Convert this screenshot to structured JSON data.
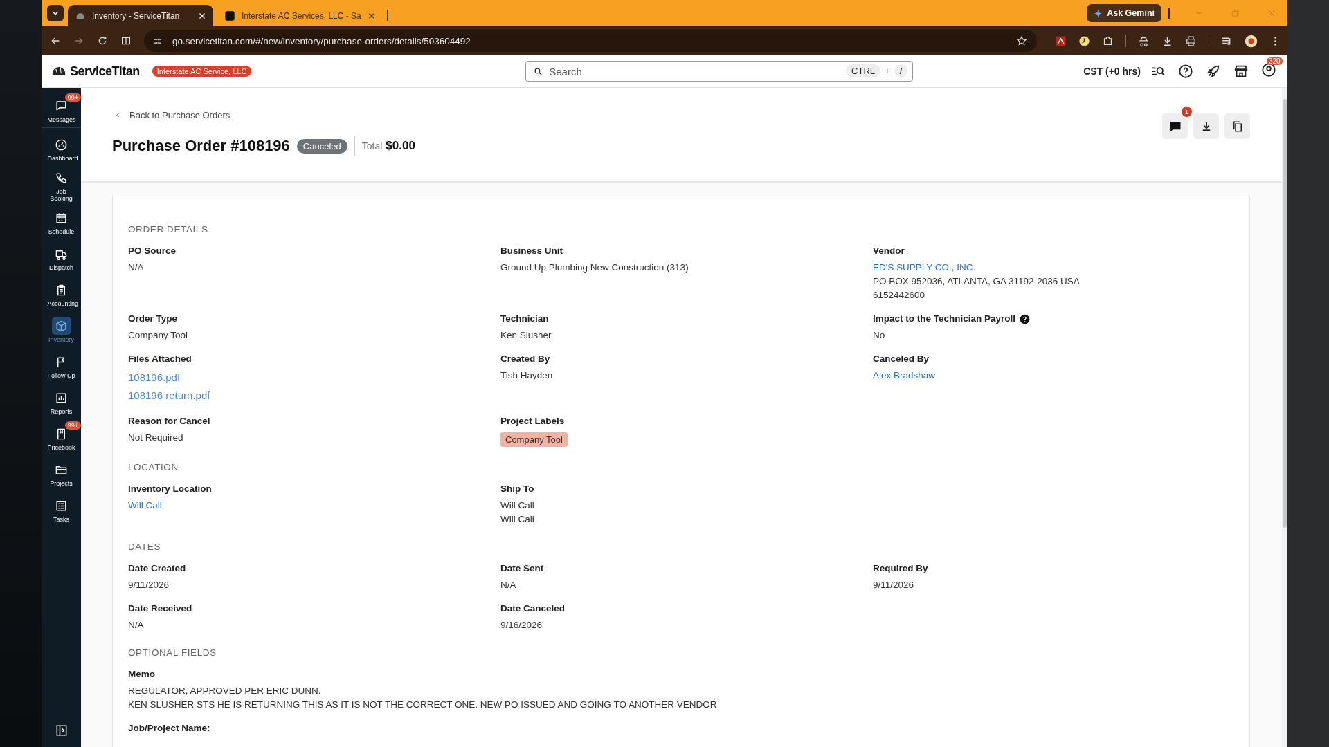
{
  "browser": {
    "tabs": [
      {
        "title": "Inventory - ServiceTitan",
        "selected": true
      },
      {
        "title": "Interstate AC Services, LLC - Sa",
        "selected": false
      }
    ],
    "address": "go.servicetitan.com/#/new/inventory/purchase-orders/details/503604492",
    "ask_button": "Ask Gemini"
  },
  "header": {
    "logo": "ServiceTitan",
    "company": "Interstate AC Service, LLC",
    "search_placeholder": "Search",
    "shortcut": [
      "CTRL",
      "+",
      "/"
    ],
    "timezone": "CST (+0 hrs)",
    "notifications": "320"
  },
  "sidebar": {
    "items": [
      {
        "label": "Messages",
        "selected": false,
        "badge": "99+"
      },
      {
        "label": "Dashboard",
        "selected": false
      },
      {
        "label": "Job Booking",
        "selected": false
      },
      {
        "label": "Schedule",
        "selected": false
      },
      {
        "label": "Dispatch",
        "selected": false
      },
      {
        "label": "Accounting",
        "selected": false
      },
      {
        "label": "Inventory",
        "selected": true
      },
      {
        "label": "Follow Up",
        "selected": false
      },
      {
        "label": "Reports",
        "selected": false
      },
      {
        "label": "Pricebook",
        "selected": false,
        "badge": "99+"
      },
      {
        "label": "Projects",
        "selected": false
      },
      {
        "label": "Tasks",
        "selected": false
      }
    ]
  },
  "page": {
    "back_link": "Back to Purchase Orders",
    "title": "Purchase Order #108196",
    "status": "Canceled",
    "total_label": "Total",
    "total_value": "$0.00",
    "comments_badge": "1"
  },
  "sections": [
    {
      "heading": "ORDER DETAILS",
      "fields": [
        {
          "label": "PO Source",
          "values": [
            {
              "kind": "text",
              "text": "N/A"
            }
          ]
        },
        {
          "label": "Business Unit",
          "values": [
            {
              "kind": "text",
              "text": "Ground Up Plumbing New Construction (313)"
            }
          ]
        },
        {
          "label": "Vendor",
          "values": [
            {
              "kind": "link",
              "text": "ED'S SUPPLY CO., INC."
            },
            {
              "kind": "text",
              "text": "PO BOX 952036, ATLANTA, GA 31192-2036 USA"
            },
            {
              "kind": "text",
              "text": "6152442600"
            }
          ]
        },
        {
          "label": "Order Type",
          "values": [
            {
              "kind": "text",
              "text": "Company Tool"
            }
          ]
        },
        {
          "label": "Technician",
          "values": [
            {
              "kind": "text",
              "text": "Ken Slusher"
            }
          ]
        },
        {
          "label": "Impact to the Technician Payroll",
          "help": true,
          "values": [
            {
              "kind": "text",
              "text": "No"
            }
          ]
        },
        {
          "label": "Files Attached",
          "values": [
            {
              "kind": "file",
              "text": "108196.pdf"
            },
            {
              "kind": "file",
              "text": "108196 return.pdf"
            }
          ]
        },
        {
          "label": "Created By",
          "values": [
            {
              "kind": "text",
              "text": "Tish Hayden"
            }
          ]
        },
        {
          "label": "Canceled By",
          "values": [
            {
              "kind": "link",
              "text": "Alex Bradshaw"
            }
          ]
        },
        {
          "label": "Reason for Cancel",
          "values": [
            {
              "kind": "text",
              "text": "Not Required"
            }
          ]
        },
        {
          "label": "Project Labels",
          "values": [
            {
              "kind": "tag",
              "text": "Company Tool"
            }
          ]
        }
      ]
    },
    {
      "heading": "LOCATION",
      "fields": [
        {
          "label": "Inventory Location",
          "values": [
            {
              "kind": "link",
              "text": "Will Call"
            }
          ]
        },
        {
          "label": "Ship To",
          "values": [
            {
              "kind": "text",
              "text": "Will Call"
            },
            {
              "kind": "text",
              "text": "Will Call"
            }
          ]
        }
      ]
    },
    {
      "heading": "DATES",
      "fields": [
        {
          "label": "Date Created",
          "values": [
            {
              "kind": "text",
              "text": "9/11/2026"
            }
          ]
        },
        {
          "label": "Date Sent",
          "values": [
            {
              "kind": "text",
              "text": "N/A"
            }
          ]
        },
        {
          "label": "Required By",
          "values": [
            {
              "kind": "text",
              "text": "9/11/2026"
            }
          ]
        },
        {
          "label": "Date Received",
          "values": [
            {
              "kind": "text",
              "text": "N/A"
            }
          ]
        },
        {
          "label": "Date Canceled",
          "values": [
            {
              "kind": "text",
              "text": "9/16/2026"
            }
          ]
        }
      ]
    },
    {
      "heading": "OPTIONAL FIELDS",
      "fields": [
        {
          "label": "Memo",
          "wide": true,
          "values": [
            {
              "kind": "text",
              "text": "REGULATOR, APPROVED PER ERIC DUNN."
            },
            {
              "kind": "text",
              "text": "KEN SLUSHER STS HE IS RETURNING THIS AS IT IS NOT THE CORRECT ONE. NEW PO ISSUED AND GOING TO ANOTHER VENDOR"
            }
          ]
        },
        {
          "label": "Job/Project Name:",
          "wide": true
        }
      ]
    }
  ]
}
